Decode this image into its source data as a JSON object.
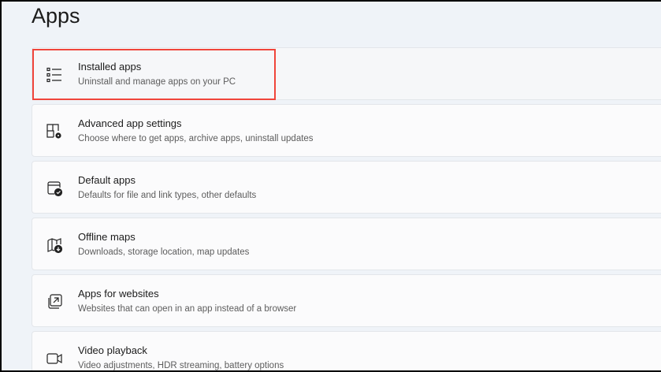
{
  "page_title": "Apps",
  "items": [
    {
      "title": "Installed apps",
      "subtitle": "Uninstall and manage apps on your PC",
      "icon": "list-icon"
    },
    {
      "title": "Advanced app settings",
      "subtitle": "Choose where to get apps, archive apps, uninstall updates",
      "icon": "app-settings-icon"
    },
    {
      "title": "Default apps",
      "subtitle": "Defaults for file and link types, other defaults",
      "icon": "default-apps-icon"
    },
    {
      "title": "Offline maps",
      "subtitle": "Downloads, storage location, map updates",
      "icon": "map-download-icon"
    },
    {
      "title": "Apps for websites",
      "subtitle": "Websites that can open in an app instead of a browser",
      "icon": "open-external-icon"
    },
    {
      "title": "Video playback",
      "subtitle": "Video adjustments, HDR streaming, battery options",
      "icon": "video-camera-icon"
    }
  ],
  "highlight_color": "#f0453b"
}
